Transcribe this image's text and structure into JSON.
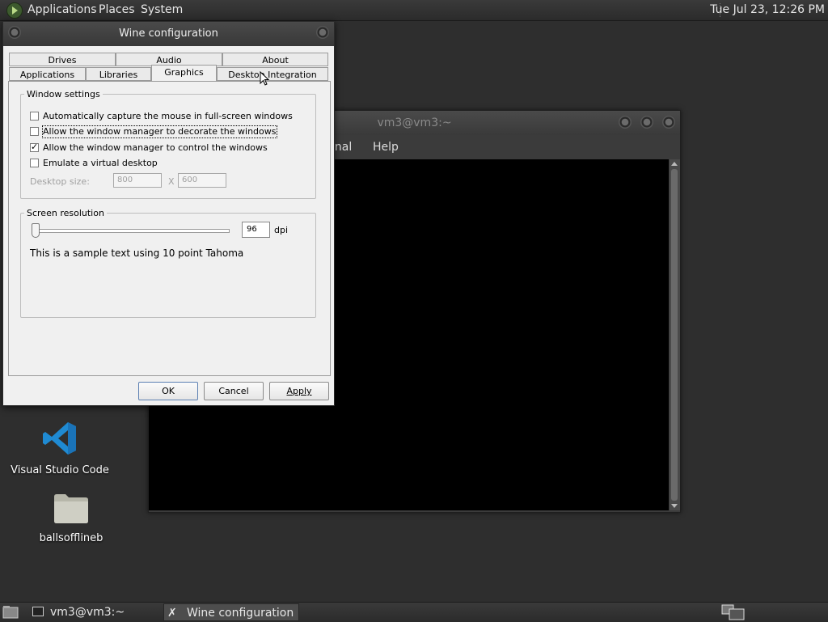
{
  "top_panel": {
    "menus": [
      "Applications",
      "Places",
      "System"
    ],
    "clock": "Tue Jul 23, 12:26 PM"
  },
  "terminal": {
    "title": "vm3@vm3:~",
    "menu": [
      "inal",
      "Help"
    ]
  },
  "desktop_icons": [
    {
      "label": "Visual Studio Code",
      "icon": "vscode-icon"
    },
    {
      "label": "ballsofflineb",
      "icon": "folder-icon"
    }
  ],
  "wine": {
    "title": "Wine configuration",
    "tabs_row1": [
      "Drives",
      "Audio",
      "About"
    ],
    "tabs_row2": [
      "Applications",
      "Libraries",
      "Graphics",
      "Desktop Integration"
    ],
    "active_tab": "Graphics",
    "window_settings": {
      "legend": "Window settings",
      "options": [
        {
          "label": "Automatically capture the mouse in full-screen windows",
          "checked": false
        },
        {
          "label": "Allow the window manager to decorate the windows",
          "checked": false
        },
        {
          "label": "Allow the window manager to control the windows",
          "checked": true
        },
        {
          "label": "Emulate a virtual desktop",
          "checked": false
        }
      ],
      "desktop_size_label": "Desktop size:",
      "width": "800",
      "x_sep": "X",
      "height": "600"
    },
    "screen_resolution": {
      "legend": "Screen resolution",
      "dpi": "96",
      "dpi_unit": "dpi",
      "slider_fraction": 0.0,
      "sample_text": "This is a sample text using 10 point Tahoma"
    },
    "buttons": {
      "ok": "OK",
      "cancel": "Cancel",
      "apply": "Apply"
    }
  },
  "taskbar": {
    "tasks": [
      "vm3@vm3:~",
      "Wine configuration"
    ],
    "active_task": "Wine configuration"
  }
}
